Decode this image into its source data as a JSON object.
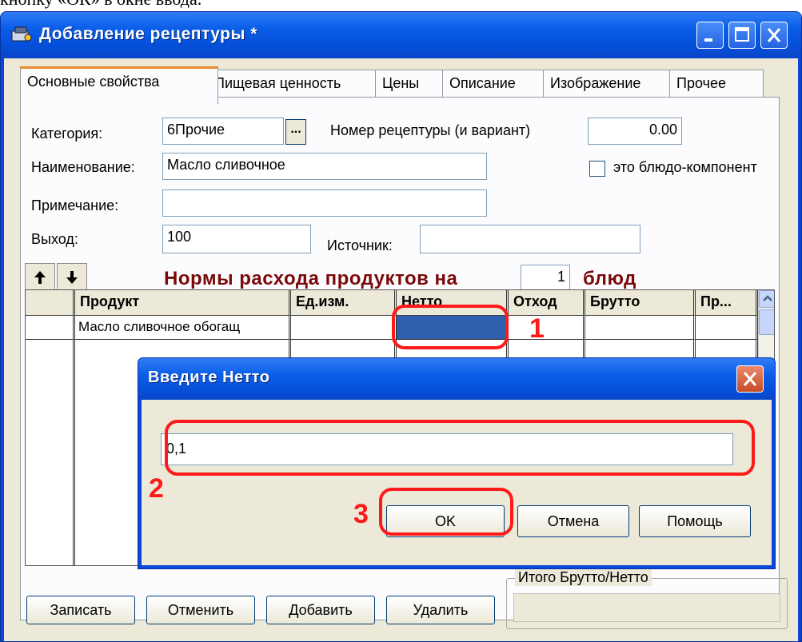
{
  "caption_fragment": "кнопку «ОК» в окне ввода.",
  "window": {
    "title": "Добавление рецептуры *",
    "tabs": [
      "Основные свойства",
      "Пищевая ценность",
      "Цены",
      "Описание",
      "Изображение",
      "Прочее"
    ],
    "active_tab": "Основные свойства"
  },
  "form": {
    "category_label": "Категория:",
    "category_value": "6Прочие",
    "ellipsis_label": "...",
    "recipe_number_label": "Номер рецептуры (и вариант)",
    "recipe_number_value": "0.00",
    "name_label": "Наименование:",
    "name_value": "Масло сливочное",
    "component_checkbox_label": "это блюдо-компонент",
    "note_label": "Примечание:",
    "note_value": "",
    "output_label": "Выход:",
    "output_value": "100",
    "source_label": "Источник:",
    "source_value": ""
  },
  "norms": {
    "heading_prefix": "Нормы расхода продуктов на",
    "portions": "1",
    "heading_suffix": "блюд"
  },
  "grid": {
    "columns": [
      "",
      "Продукт",
      "Ед.изм.",
      "Нетто",
      "Отход",
      "Брутто",
      "Пр..."
    ],
    "rows": [
      [
        "",
        "Масло сливочное обогащ",
        "",
        "",
        "",
        "",
        ""
      ]
    ]
  },
  "bottom": {
    "save_label": "Записать",
    "cancel_label": "Отменить",
    "add_label": "Добавить",
    "delete_label": "Удалить",
    "totals_label": "Итого Брутто/Нетто"
  },
  "dialog": {
    "title": "Введите Нетто",
    "input_value": "0,1",
    "ok_label": "OK",
    "cancel_label": "Отмена",
    "help_label": "Помощь"
  },
  "annotations": {
    "mark_1": "1",
    "mark_2": "2",
    "mark_3": "3",
    "color": "#ff1a1a"
  }
}
